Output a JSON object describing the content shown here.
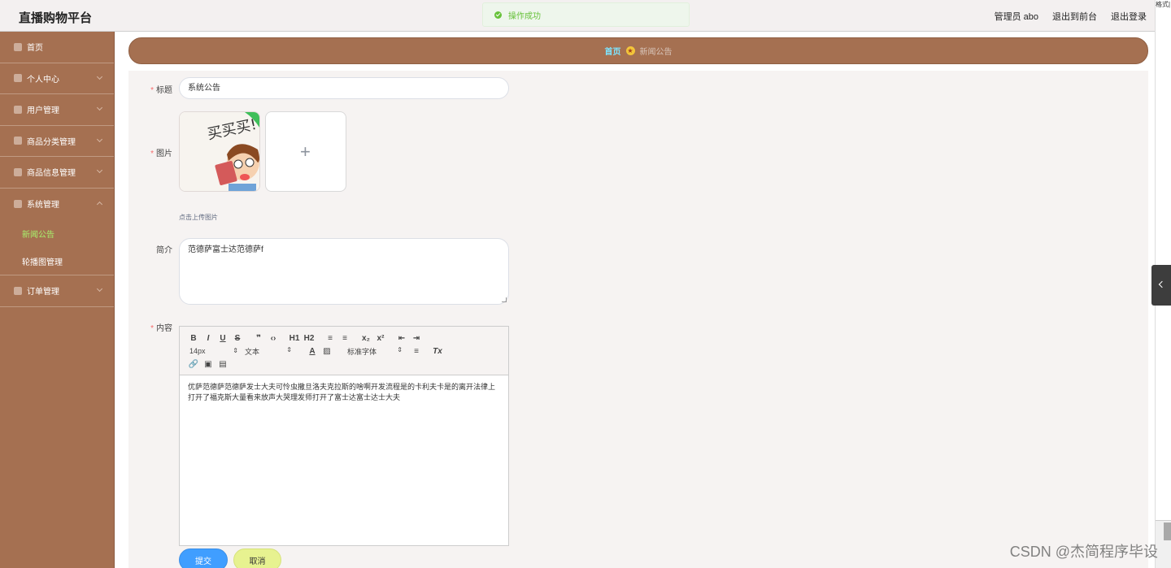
{
  "app": {
    "title": "直播购物平台"
  },
  "header": {
    "user_label": "管理员 abo",
    "exit_front": "退出到前台",
    "logout": "退出登录"
  },
  "toast": {
    "message": "操作成功",
    "color": "#67c23a"
  },
  "sidebar": {
    "items": [
      {
        "label": "首页",
        "icon": "home-icon"
      },
      {
        "label": "个人中心",
        "icon": "user-icon"
      },
      {
        "label": "用户管理",
        "icon": "send-icon"
      },
      {
        "label": "商品分类管理",
        "icon": "user-icon"
      },
      {
        "label": "商品信息管理",
        "icon": "monitor-icon"
      },
      {
        "label": "系统管理",
        "icon": "shop-icon",
        "expanded": true,
        "children": [
          {
            "label": "新闻公告",
            "active": true
          },
          {
            "label": "轮播图管理"
          }
        ]
      },
      {
        "label": "订单管理",
        "icon": "grid-icon"
      }
    ]
  },
  "breadcrumb": {
    "home": "首页",
    "current": "新闻公告"
  },
  "form": {
    "title_label": "标题",
    "title_value": "系统公告",
    "image_label": "图片",
    "upload_hint": "点击上传图片",
    "intro_label": "简介",
    "intro_value": "范德萨富士达范德萨f",
    "content_label": "内容",
    "content_text": "优萨范德萨范德萨发士大夫可怜虫撒旦洛夫克拉斯的啥啊开发流程是的卡利夫卡是的离开法律上打开了福克斯大量看来放声大哭理发师打开了富士达富士达士大夫",
    "submit": "提交",
    "cancel": "取消"
  },
  "editor": {
    "toolbar_row1": [
      "B",
      "I",
      "U",
      "S",
      "❞",
      "‹›",
      "H1",
      "H2",
      "≡",
      "≡",
      "x₂",
      "x²",
      "⇤",
      "⇥"
    ],
    "font_size": "14px",
    "paragraph": "文本",
    "font_family": "标准字体"
  },
  "right_panel": {
    "fragment": "格式|"
  },
  "watermark": "CSDN @杰简程序毕设",
  "colors": {
    "sidebar": "#a57051",
    "accent_link": "#7de5ff",
    "active_menu": "#a8f06d",
    "primary": "#409eff",
    "cancel": "#e7f290"
  }
}
